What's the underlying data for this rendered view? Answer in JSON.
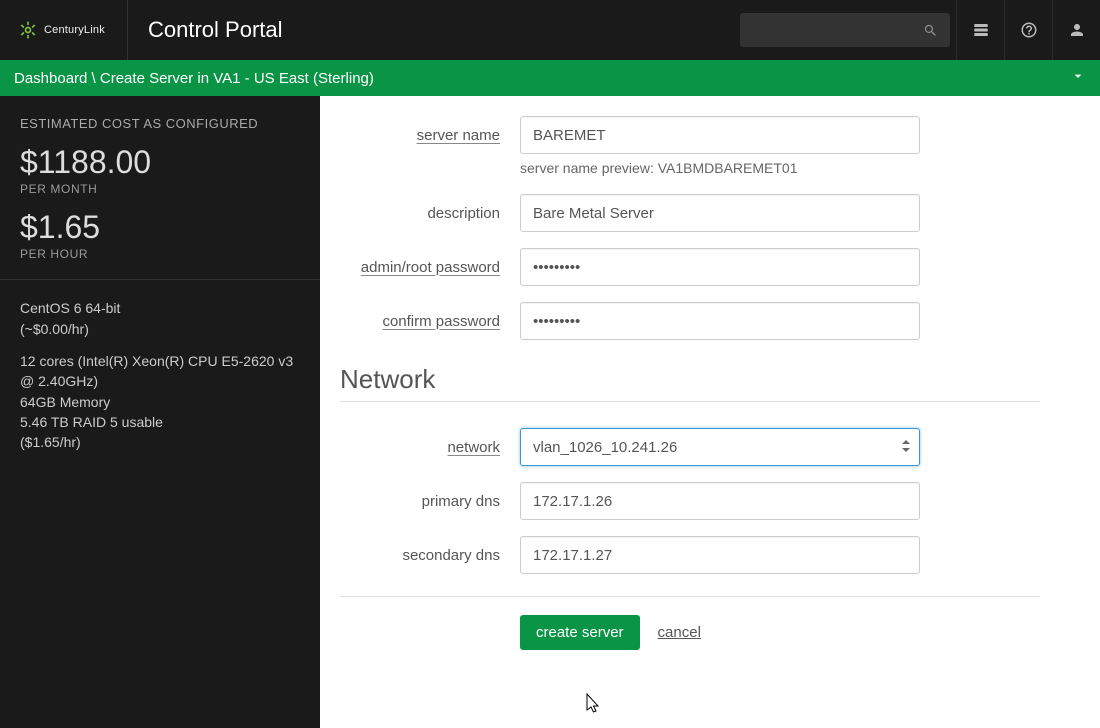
{
  "header": {
    "brand": "CenturyLink",
    "app_title": "Control Portal"
  },
  "breadcrumb": {
    "text": "Dashboard \\ Create Server in VA1 - US East (Sterling)"
  },
  "sidebar": {
    "cost_heading": "ESTIMATED COST AS CONFIGURED",
    "monthly_price": "$1188.00",
    "per_month": "PER MONTH",
    "hourly_price": "$1.65",
    "per_hour": "PER HOUR",
    "os_line_1": "CentOS 6 64-bit",
    "os_line_2": "(~$0.00/hr)",
    "cpu_line": "12 cores (Intel(R) Xeon(R) CPU E5-2620 v3 @ 2.40GHz)",
    "mem_line": "64GB Memory",
    "disk_line": "5.46 TB RAID 5 usable",
    "rate_line": "($1.65/hr)"
  },
  "form": {
    "server_name_label": "server name",
    "server_name_value": "BAREMET",
    "preview_label": "server name preview: ",
    "preview_value": "VA1BMDBAREMET01",
    "description_label": "description",
    "description_value": "Bare Metal Server",
    "password_label": "admin/root password",
    "password_value": "•••••••••",
    "confirm_label": "confirm password",
    "confirm_value": "•••••••••",
    "network_heading": "Network",
    "network_label": "network",
    "network_value": "vlan_1026_10.241.26",
    "primary_dns_label": "primary dns",
    "primary_dns_value": "172.17.1.26",
    "secondary_dns_label": "secondary dns",
    "secondary_dns_value": "172.17.1.27",
    "create_button": "create server",
    "cancel_link": "cancel"
  }
}
